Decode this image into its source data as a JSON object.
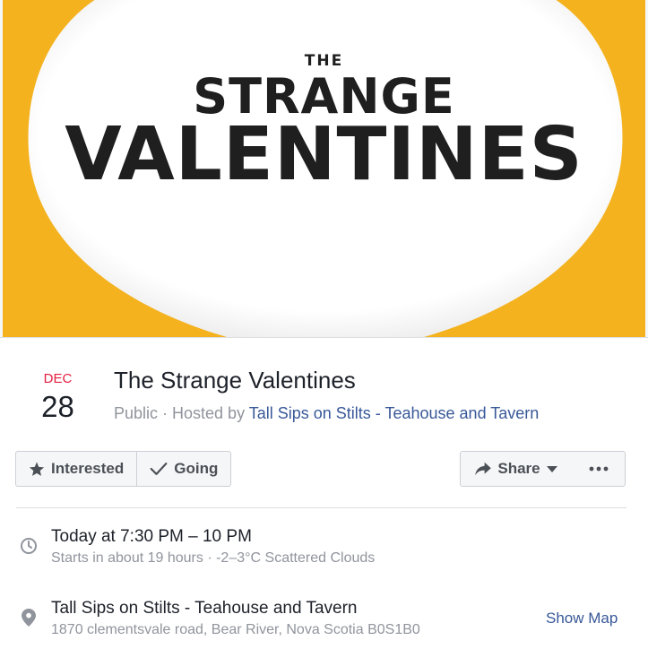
{
  "cover": {
    "line_the": "THE",
    "line_1": "STRANGE",
    "line_2": "VALENTINES"
  },
  "event": {
    "month": "DEC",
    "day": "28",
    "title": "The Strange Valentines",
    "privacy": "Public",
    "separator": " · Hosted by ",
    "host": "Tall Sips on Stilts - Teahouse and Tavern"
  },
  "actions": {
    "interested_label": "Interested",
    "going_label": "Going",
    "share_label": "Share"
  },
  "details": {
    "time": "Today at 7:30 PM – 10 PM",
    "time_sub": "Starts in about 19 hours · -2–3°C Scattered Clouds",
    "place": "Tall Sips on Stilts - Teahouse and Tavern",
    "address": "1870 clementsvale road, Bear River, Nova Scotia B0S1B0",
    "show_map_label": "Show Map"
  },
  "icons": {
    "star": "star-icon",
    "check": "check-icon",
    "share": "share-arrow-icon",
    "caret": "caret-down-icon",
    "more": "more-dots-icon",
    "clock": "clock-icon",
    "pin": "map-pin-icon"
  },
  "colors": {
    "cover_background": "#f4b21e",
    "date_month": "#e41e3f",
    "link": "#385898",
    "muted": "#90949c"
  }
}
